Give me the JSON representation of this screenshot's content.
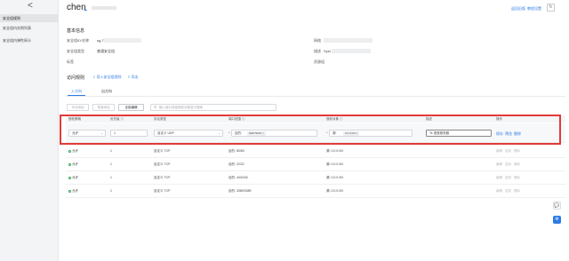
{
  "sidebar": {
    "back": "<",
    "items": [
      {
        "label": "安全组规则",
        "active": true
      },
      {
        "label": "安全组内实例列表",
        "active": false
      },
      {
        "label": "安全组内弹性网卡",
        "active": false
      }
    ]
  },
  "header": {
    "title": "chen",
    "title_mark": "☁",
    "links": [
      "返回旧版",
      "教程设置"
    ],
    "refresh_icon": "↻"
  },
  "basic": {
    "section": "基本信息",
    "labels": {
      "id": "安全组ID/名称",
      "type": "安全组类型",
      "tags": "标签",
      "network": "网络",
      "desc": "描述",
      "group": "资源组"
    },
    "values": {
      "id_prefix": "sg-7",
      "type": "普通安全组",
      "desc_prefix": "Syst"
    }
  },
  "rules": {
    "section": "访问规则",
    "actions": [
      "导入安全组规则",
      "导出"
    ],
    "tabs": [
      {
        "label": "入方向",
        "active": true
      },
      {
        "label": "出方向",
        "active": false
      }
    ],
    "toolbar": {
      "buttons": [
        "手动添加",
        "快速添加",
        "全部编辑"
      ],
      "search_placeholder": "输入端口或者授权对象进行搜索"
    },
    "columns": [
      "授权策略",
      "优先级 ⓘ",
      "协议类型",
      "端口范围 ⓘ",
      "授权对象 ⓘ",
      "描述",
      "操作"
    ],
    "edit_row": {
      "policy": "允许",
      "priority": "1",
      "protocol": "自定义 UDP",
      "port_prefix": "目的:",
      "port_tag": "9987/9987 ×",
      "object_prefix": "源:",
      "object_tag": "0.0.0.0/0 ×",
      "description": "Ts 语音服务器",
      "save": "保存",
      "preview": "预览",
      "delete": "删除"
    },
    "rows": [
      {
        "policy": "允许",
        "priority": "1",
        "protocol": "自定义 TCP",
        "port": "目的: 80/80",
        "object": "源: 0.0.0.0/0"
      },
      {
        "policy": "允许",
        "priority": "1",
        "protocol": "自定义 TCP",
        "port": "目的: 22/22",
        "object": "源: 0.0.0.0/0"
      },
      {
        "policy": "允许",
        "priority": "1",
        "protocol": "自定义 TCP",
        "port": "目的: 443/443",
        "object": "源: 0.0.0.0/0"
      },
      {
        "policy": "允许",
        "priority": "1",
        "protocol": "自定义 TCP",
        "port": "目的: 3389/3389",
        "object": "源: 0.0.0.0/0"
      }
    ],
    "row_actions": [
      "编辑",
      "复制",
      "删除"
    ]
  },
  "floating": {
    "chat_icon": "💬",
    "help_icon": "⚙"
  },
  "colors": {
    "accent": "#2e7be6",
    "highlight": "#e23a3a",
    "allow": "#2fa84f"
  }
}
